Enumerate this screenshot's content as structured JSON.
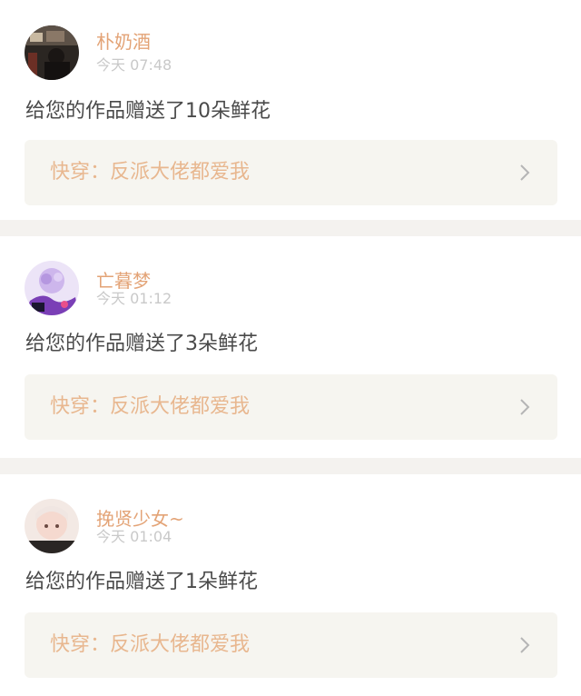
{
  "notifications": [
    {
      "username": "朴奶酒",
      "time": "今天 07:48",
      "message": "给您的作品赠送了10朵鲜花",
      "work_title": "快穿：反派大佬都爱我"
    },
    {
      "username": "亡暮梦",
      "time": "今天 01:12",
      "message": "给您的作品赠送了3朵鲜花",
      "work_title": "快穿：反派大佬都爱我"
    },
    {
      "username": "挽贤少女~",
      "time": "今天 01:04",
      "message": "给您的作品赠送了1朵鲜花",
      "work_title": "快穿：反派大佬都爱我"
    }
  ],
  "colors": {
    "username": "#e3a376",
    "time": "#c9c9c9",
    "message": "#4a4a4a",
    "work_title": "#e8b78f",
    "work_bg": "#f6f5f0",
    "separator": "#f4f2ef"
  },
  "icons": {
    "chevron": "chevron-right-icon"
  }
}
